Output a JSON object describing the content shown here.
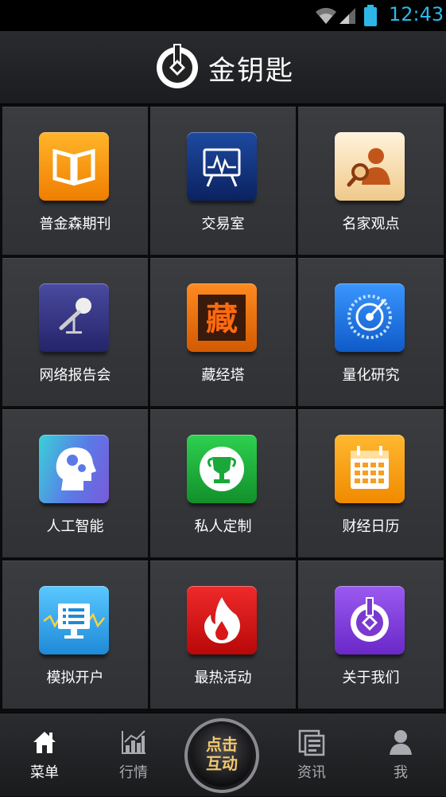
{
  "status_bar": {
    "time": "12:43"
  },
  "header": {
    "title": "金钥匙"
  },
  "menu": [
    {
      "label": "普金森期刊",
      "icon": "book-icon",
      "color": "#f08a00"
    },
    {
      "label": "交易室",
      "icon": "presentation-icon",
      "color": "#12307a"
    },
    {
      "label": "名家观点",
      "icon": "expert-search-icon",
      "color": "#f5d9a8"
    },
    {
      "label": "网络报告会",
      "icon": "microphone-icon",
      "color": "#3a3a80"
    },
    {
      "label": "藏经塔",
      "icon": "zang-character-icon",
      "color": "#e07010"
    },
    {
      "label": "量化研究",
      "icon": "dial-icon",
      "color": "#1e6fd6"
    },
    {
      "label": "人工智能",
      "icon": "head-gears-icon",
      "color": "#4fc3e0"
    },
    {
      "label": "私人定制",
      "icon": "trophy-icon",
      "color": "#1aa83a"
    },
    {
      "label": "财经日历",
      "icon": "calendar-icon",
      "color": "#f39a10"
    },
    {
      "label": "模拟开户",
      "icon": "monitor-icon",
      "color": "#2aa0e0"
    },
    {
      "label": "最热活动",
      "icon": "flame-icon",
      "color": "#d81818"
    },
    {
      "label": "关于我们",
      "icon": "key-logo-icon",
      "color": "#7a3ad0"
    }
  ],
  "tabs": [
    {
      "label": "菜单",
      "icon": "home-icon",
      "active": true
    },
    {
      "label": "行情",
      "icon": "chart-icon",
      "active": false
    },
    {
      "label": "资讯",
      "icon": "news-icon",
      "active": false
    },
    {
      "label": "我",
      "icon": "person-icon",
      "active": false
    }
  ],
  "center_button": {
    "line1": "点击",
    "line2": "互动"
  }
}
